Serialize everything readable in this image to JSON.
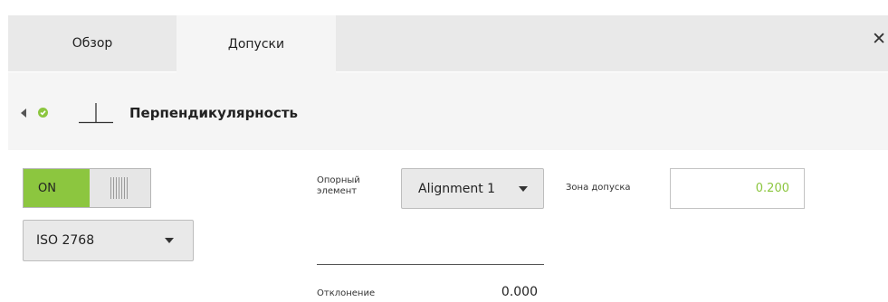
{
  "tabs": [
    {
      "label": "Обзор",
      "active": false
    },
    {
      "label": "Допуски",
      "active": true
    }
  ],
  "close_icon": "close-icon",
  "header": {
    "title": "Перпендикулярность",
    "icons": [
      "back-arrow-icon",
      "check-icon",
      "perpendicularity-icon"
    ]
  },
  "toggle": {
    "label": "ON",
    "state": "on"
  },
  "standard_dropdown": {
    "value": "ISO 2768"
  },
  "reference": {
    "label": "Опорный элемент",
    "value": "Alignment 1"
  },
  "tolerance_zone": {
    "label": "Зона допуска",
    "value": "0.200"
  },
  "deviation": {
    "label": "Отклонение",
    "value": "0.000"
  },
  "colors": {
    "accent": "#8cc63f",
    "tab_bar": "#e9e9e9",
    "panel": "#f5f5f5"
  }
}
